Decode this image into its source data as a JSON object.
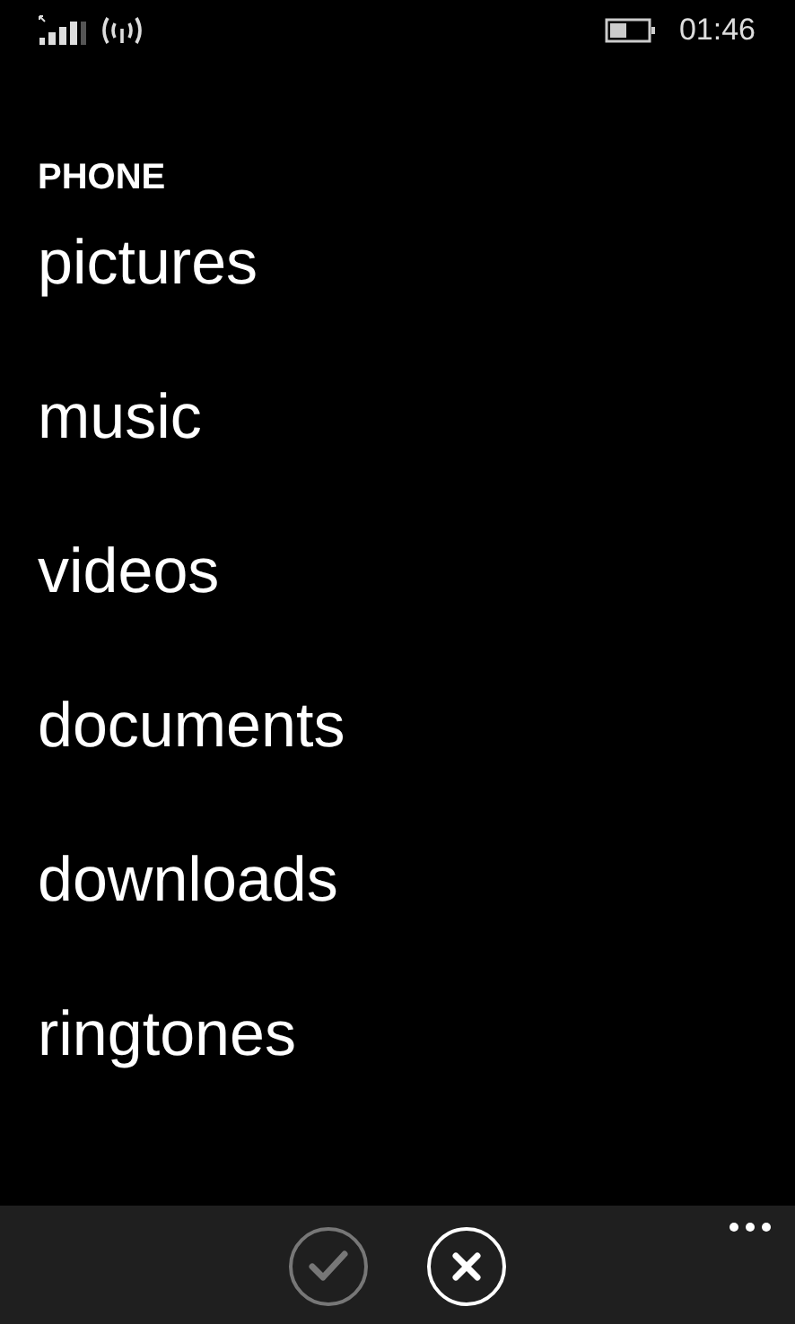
{
  "status_bar": {
    "time": "01:46"
  },
  "header": "PHONE",
  "items": [
    "pictures",
    "music",
    "videos",
    "documents",
    "downloads",
    "ringtones"
  ],
  "app_bar": {
    "buttons": [
      {
        "kind": "accept",
        "disabled": true
      },
      {
        "kind": "cancel",
        "disabled": false
      }
    ]
  }
}
